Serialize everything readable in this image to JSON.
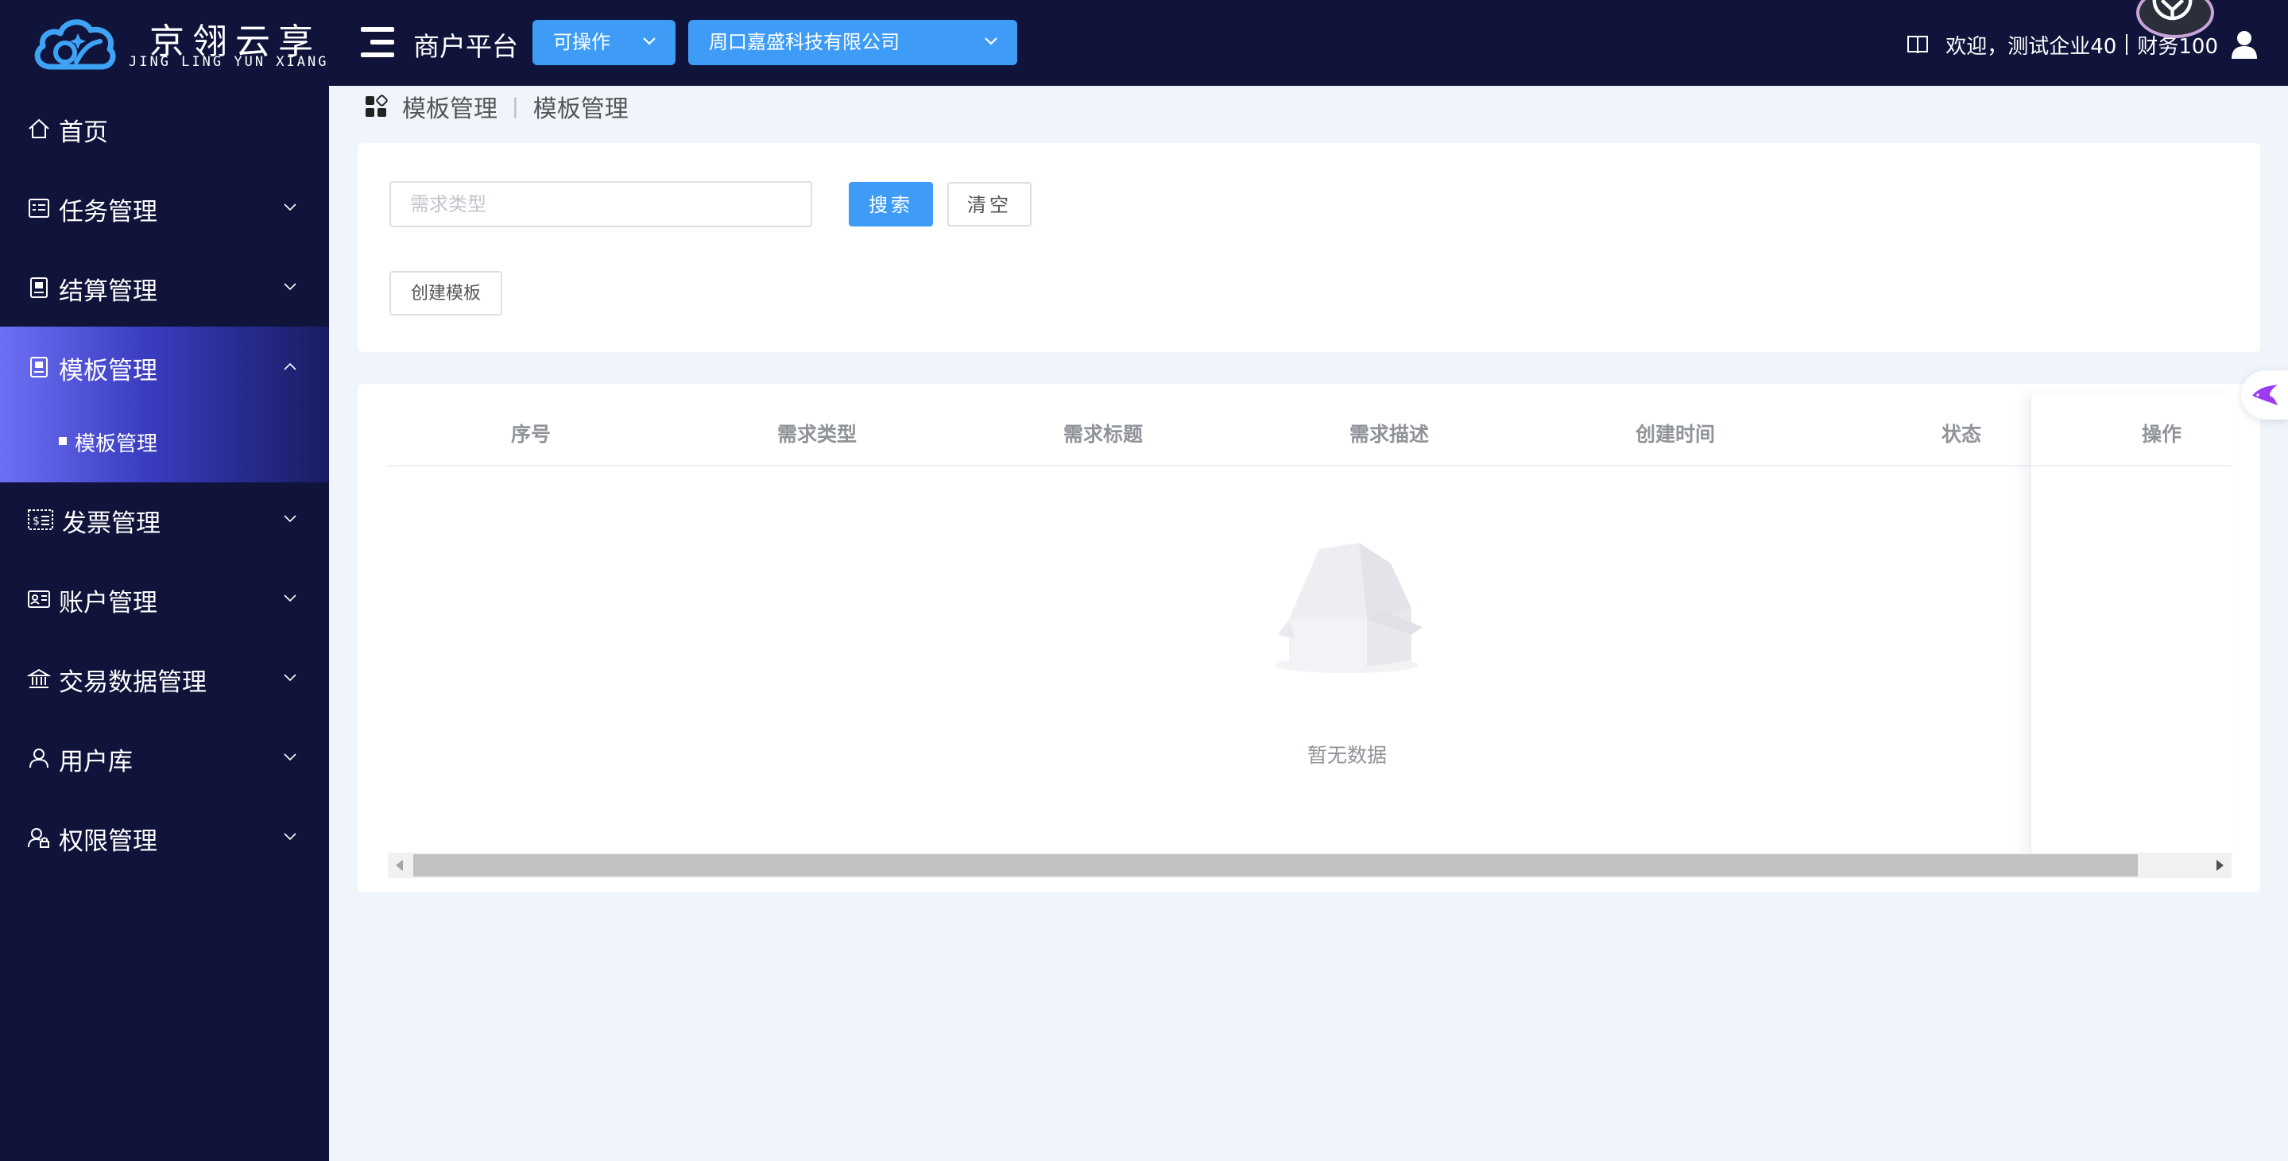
{
  "header": {
    "logo_cn": "京翎云享",
    "logo_en": "JING LING YUN XIANG",
    "platform_title": "商户平台",
    "status_select": "可操作",
    "company_select": "周口嘉盛科技有限公司",
    "welcome": "欢迎，测试企业40",
    "role": "财务100"
  },
  "sidebar": {
    "items": [
      {
        "label": "首页",
        "icon": "home-icon"
      },
      {
        "label": "任务管理",
        "icon": "task-icon"
      },
      {
        "label": "结算管理",
        "icon": "settlement-icon"
      },
      {
        "label": "模板管理",
        "icon": "template-icon"
      },
      {
        "label": "发票管理",
        "icon": "invoice-icon"
      },
      {
        "label": "账户管理",
        "icon": "account-icon"
      },
      {
        "label": "交易数据管理",
        "icon": "bank-icon"
      },
      {
        "label": "用户库",
        "icon": "user-icon"
      },
      {
        "label": "权限管理",
        "icon": "permission-icon"
      }
    ],
    "active_sub": "模板管理"
  },
  "breadcrumb": {
    "parent": "模板管理",
    "separator": "|",
    "current": "模板管理"
  },
  "search": {
    "placeholder": "需求类型",
    "search_label": "搜索",
    "clear_label": "清空",
    "create_label": "创建模板"
  },
  "table": {
    "columns": [
      "序号",
      "需求类型",
      "需求标题",
      "需求描述",
      "创建时间",
      "状态",
      "操作"
    ],
    "empty_text": "暂无数据"
  },
  "colors": {
    "sidebar_bg": "#10143a",
    "primary": "#3f9cf6",
    "page_bg": "#f0f4fb"
  }
}
